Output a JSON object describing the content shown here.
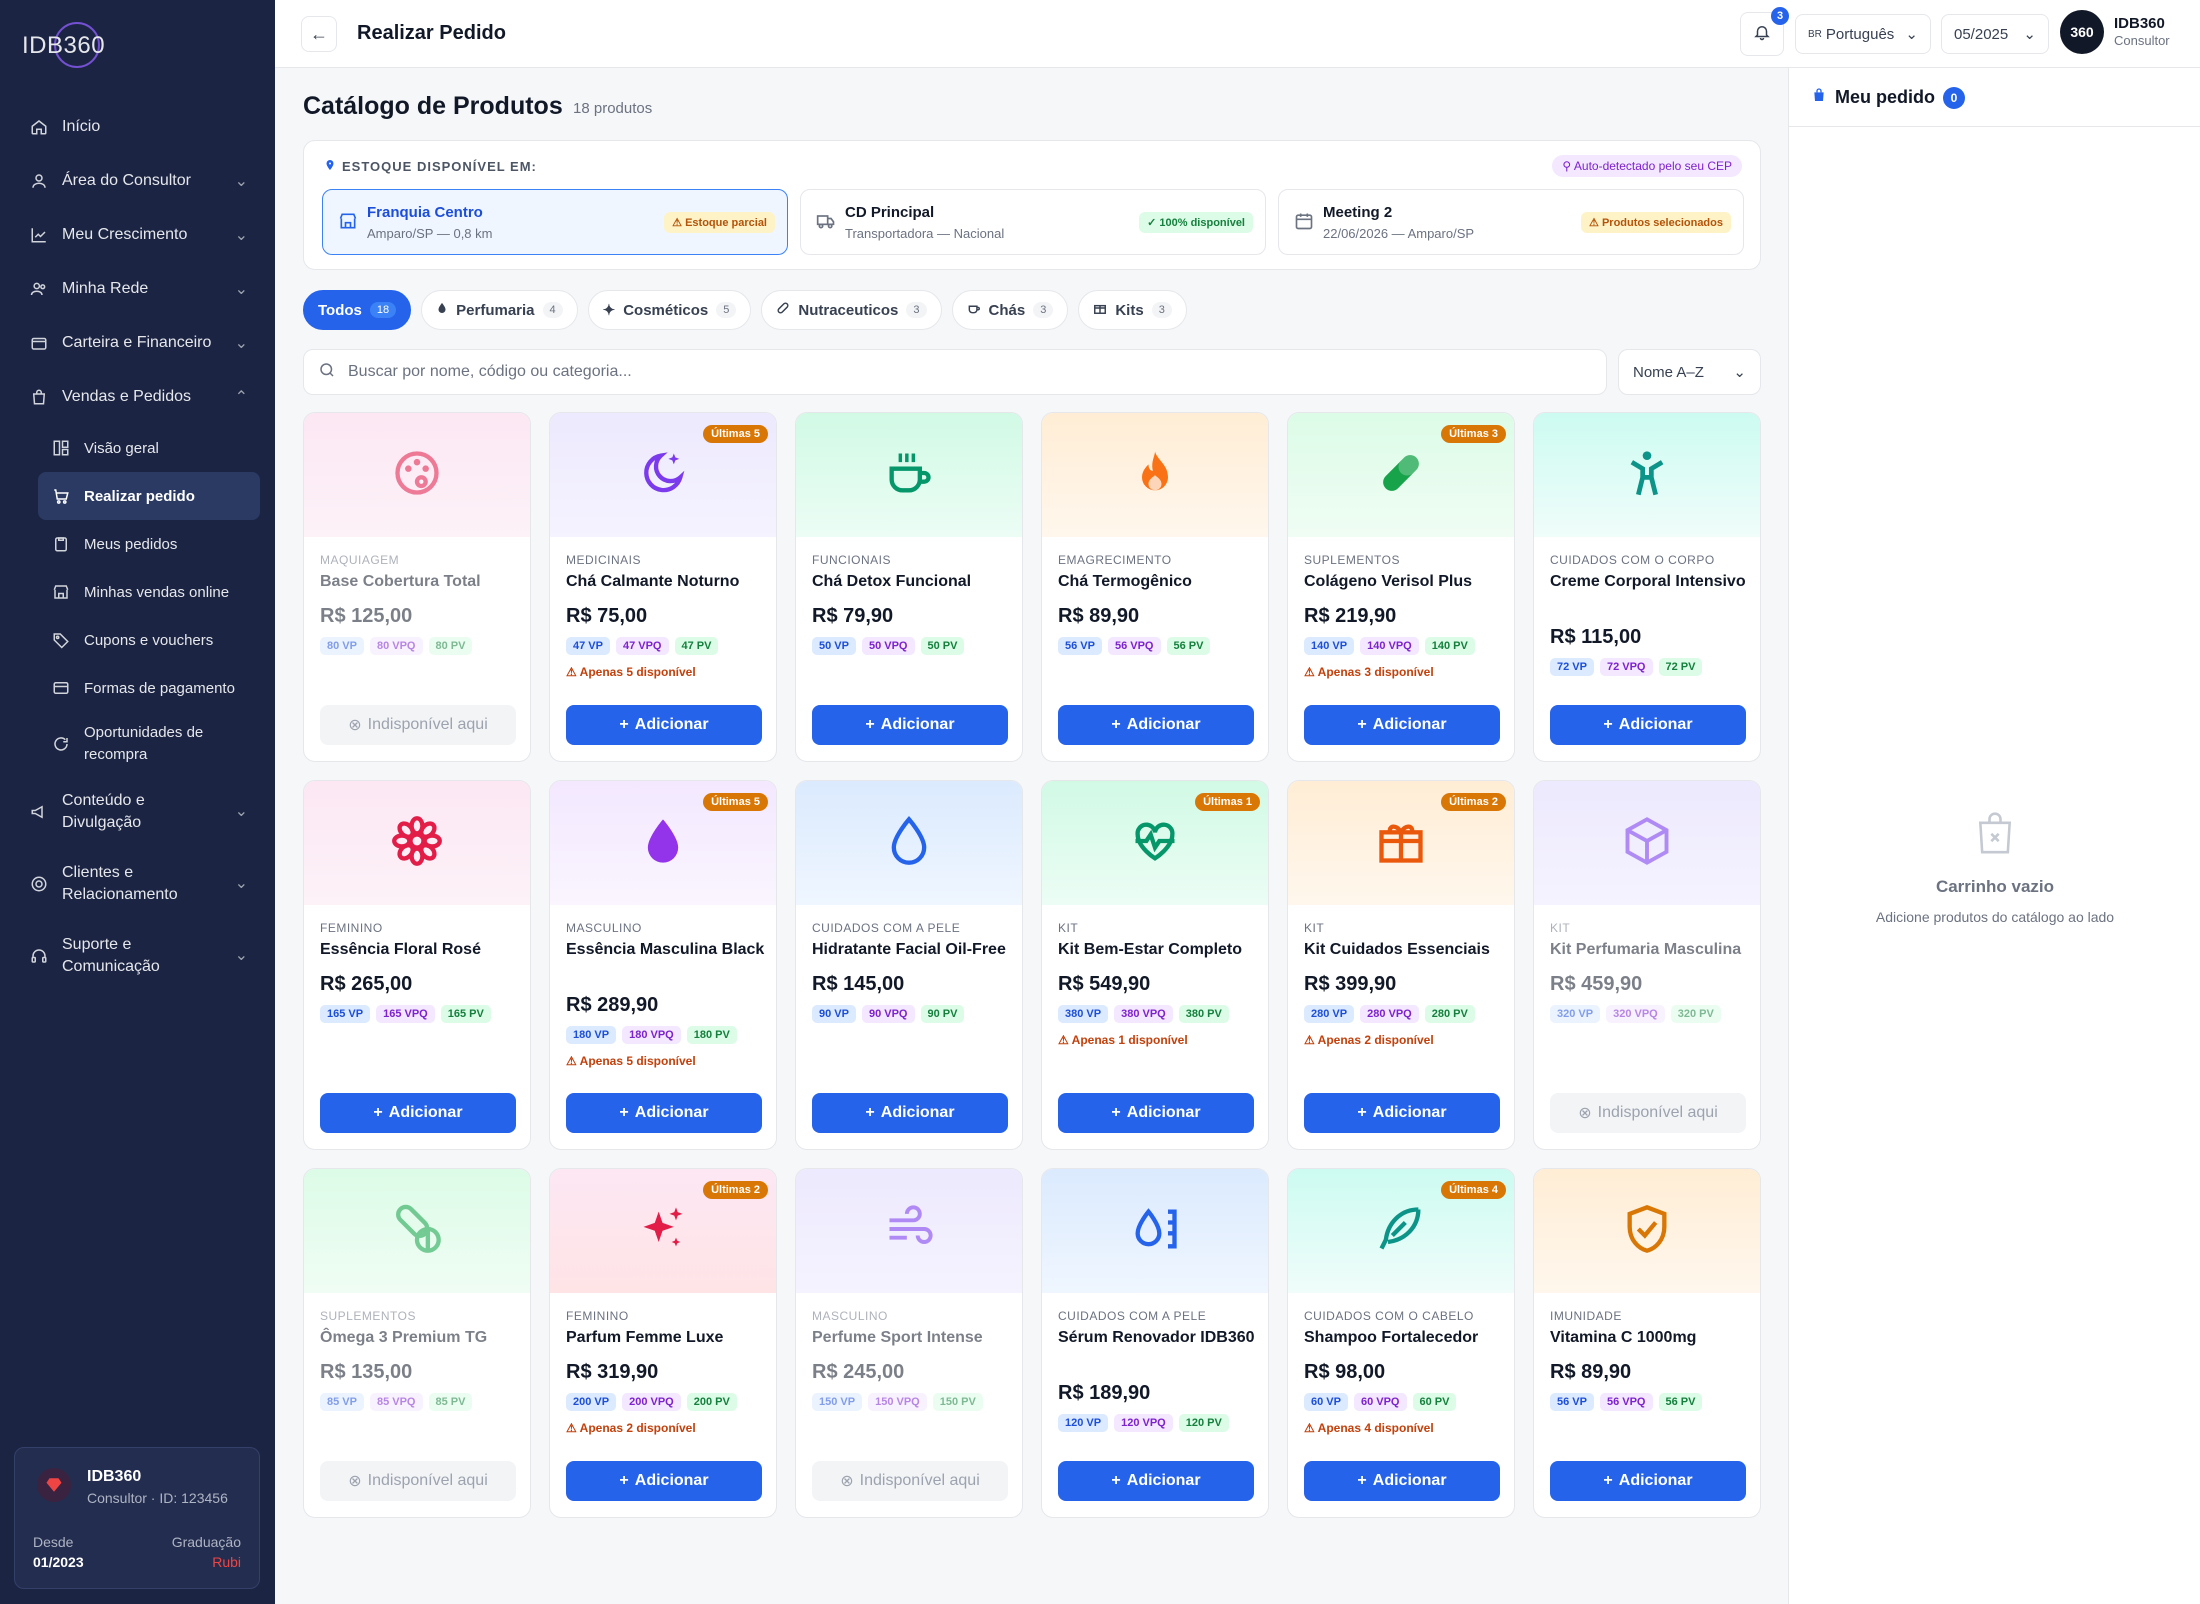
{
  "app": {
    "logo": "IDB360"
  },
  "sidebar": {
    "items": [
      {
        "label": "Início"
      },
      {
        "label": "Área do Consultor"
      },
      {
        "label": "Meu Crescimento"
      },
      {
        "label": "Minha Rede"
      },
      {
        "label": "Carteira e Financeiro"
      },
      {
        "label": "Vendas e Pedidos"
      }
    ],
    "sub": [
      {
        "label": "Visão geral"
      },
      {
        "label": "Realizar pedido"
      },
      {
        "label": "Meus pedidos"
      },
      {
        "label": "Minhas vendas online"
      },
      {
        "label": "Cupons e vouchers"
      },
      {
        "label": "Formas de pagamento"
      },
      {
        "label": "Oportunidades de recompra"
      }
    ],
    "items2": [
      {
        "label": "Conteúdo e Divulgação"
      },
      {
        "label": "Clientes e Relacionamento"
      },
      {
        "label": "Suporte e Comunicação"
      }
    ],
    "profile": {
      "name": "IDB360",
      "sub": "Consultor · ID: 123456",
      "since_label": "Desde",
      "since": "01/2023",
      "grad_label": "Graduação",
      "grad": "Rubi"
    }
  },
  "topbar": {
    "title": "Realizar Pedido",
    "notifications": "3",
    "language": "Português",
    "language_flag": "BR",
    "period": "05/2025",
    "avatar": "360",
    "user": "IDB360",
    "role": "Consultor"
  },
  "catalog": {
    "title": "Catálogo de Produtos",
    "count": "18 produtos"
  },
  "stock": {
    "label": "ESTOQUE DISPONÍVEL EM:",
    "auto": "Auto-detectado pelo seu CEP",
    "locations": [
      {
        "title": "Franquia Centro",
        "sub": "Amparo/SP — 0,8 km",
        "badge": "⚠ Estoque parcial"
      },
      {
        "title": "CD Principal",
        "sub": "Transportadora — Nacional",
        "badge": "✓ 100% disponível"
      },
      {
        "title": "Meeting 2",
        "sub": "22/06/2026 — Amparo/SP",
        "badge": "⚠ Produtos selecionados"
      }
    ]
  },
  "tabs": [
    {
      "label": "Todos",
      "count": "18"
    },
    {
      "label": "Perfumaria",
      "count": "4"
    },
    {
      "label": "Cosméticos",
      "count": "5"
    },
    {
      "label": "Nutraceuticos",
      "count": "3"
    },
    {
      "label": "Chás",
      "count": "3"
    },
    {
      "label": "Kits",
      "count": "3"
    }
  ],
  "search": {
    "placeholder": "Buscar por nome, código ou categoria..."
  },
  "sort": {
    "value": "Nome A–Z"
  },
  "actions": {
    "add": "Adicionar",
    "unavailable": "Indisponível aqui"
  },
  "products": [
    {
      "cat": "MAQUIAGEM",
      "name": "Base Cobertura Total",
      "price": "R$ 125,00",
      "vp": "80 VP",
      "vpq": "80 VPQ",
      "pv": "80 PV",
      "icon": "palette-icon"
    },
    {
      "cat": "MEDICINAIS",
      "name": "Chá Calmante Noturno",
      "price": "R$ 75,00",
      "vp": "47 VP",
      "vpq": "47 VPQ",
      "pv": "47 PV",
      "warn": "⚠ Apenas 5 disponível",
      "badge": "Últimas 5",
      "icon": "moon-stars-icon"
    },
    {
      "cat": "FUNCIONAIS",
      "name": "Chá Detox Funcional",
      "price": "R$ 79,90",
      "vp": "50 VP",
      "vpq": "50 VPQ",
      "pv": "50 PV",
      "icon": "coffee-cup-icon"
    },
    {
      "cat": "EMAGRECIMENTO",
      "name": "Chá Termogênico",
      "price": "R$ 89,90",
      "vp": "56 VP",
      "vpq": "56 VPQ",
      "pv": "56 PV",
      "icon": "flame-icon"
    },
    {
      "cat": "SUPLEMENTOS",
      "name": "Colágeno Verisol Plus",
      "price": "R$ 219,90",
      "vp": "140 VP",
      "vpq": "140 VPQ",
      "pv": "140 PV",
      "warn": "⚠ Apenas 3 disponível",
      "badge": "Últimas 3",
      "icon": "pill-icon"
    },
    {
      "cat": "CUIDADOS COM O CORPO",
      "name": "Creme Corporal Intensivo",
      "price": "R$ 115,00",
      "vp": "72 VP",
      "vpq": "72 VPQ",
      "pv": "72 PV",
      "icon": "person-standing-icon"
    },
    {
      "cat": "FEMININO",
      "name": "Essência Floral Rosé",
      "price": "R$ 265,00",
      "vp": "165 VP",
      "vpq": "165 VPQ",
      "pv": "165 PV",
      "icon": "flower-icon"
    },
    {
      "cat": "MASCULINO",
      "name": "Essência Masculina Black",
      "price": "R$ 289,90",
      "vp": "180 VP",
      "vpq": "180 VPQ",
      "pv": "180 PV",
      "warn": "⚠ Apenas 5 disponível",
      "badge": "Últimas 5",
      "icon": "drop-filled-icon"
    },
    {
      "cat": "CUIDADOS COM A PELE",
      "name": "Hidratante Facial Oil-Free",
      "price": "R$ 145,00",
      "vp": "90 VP",
      "vpq": "90 VPQ",
      "pv": "90 PV",
      "icon": "droplet-icon"
    },
    {
      "cat": "KIT",
      "name": "Kit Bem-Estar Completo",
      "price": "R$ 549,90",
      "vp": "380 VP",
      "vpq": "380 VPQ",
      "pv": "380 PV",
      "warn": "⚠ Apenas 1 disponível",
      "badge": "Últimas 1",
      "icon": "heart-pulse-icon"
    },
    {
      "cat": "KIT",
      "name": "Kit Cuidados Essenciais",
      "price": "R$ 399,90",
      "vp": "280 VP",
      "vpq": "280 VPQ",
      "pv": "280 PV",
      "warn": "⚠ Apenas 2 disponível",
      "badge": "Últimas 2",
      "icon": "gift-icon"
    },
    {
      "cat": "KIT",
      "name": "Kit Perfumaria Masculina",
      "price": "R$ 459,90",
      "vp": "320 VP",
      "vpq": "320 VPQ",
      "pv": "320 PV",
      "icon": "package-icon"
    },
    {
      "cat": "SUPLEMENTOS",
      "name": "Ômega 3 Premium TG",
      "price": "R$ 135,00",
      "vp": "85 VP",
      "vpq": "85 VPQ",
      "pv": "85 PV",
      "icon": "pills-icon"
    },
    {
      "cat": "FEMININO",
      "name": "Parfum Femme Luxe",
      "price": "R$ 319,90",
      "vp": "200 VP",
      "vpq": "200 VPQ",
      "pv": "200 PV",
      "warn": "⚠ Apenas 2 disponível",
      "badge": "Últimas 2",
      "icon": "sparkles-icon"
    },
    {
      "cat": "MASCULINO",
      "name": "Perfume Sport Intense",
      "price": "R$ 245,00",
      "vp": "150 VP",
      "vpq": "150 VPQ",
      "pv": "150 PV",
      "icon": "wind-icon"
    },
    {
      "cat": "CUIDADOS COM A PELE",
      "name": "Sérum Renovador IDB360",
      "price": "R$ 189,90",
      "vp": "120 VP",
      "vpq": "120 VPQ",
      "pv": "120 PV",
      "icon": "serum-drop-icon"
    },
    {
      "cat": "CUIDADOS COM O CABELO",
      "name": "Shampoo Fortalecedor",
      "price": "R$ 98,00",
      "vp": "60 VP",
      "vpq": "60 VPQ",
      "pv": "60 PV",
      "warn": "⚠ Apenas 4 disponível",
      "badge": "Últimas 4",
      "icon": "feather-icon"
    },
    {
      "cat": "IMUNIDADE",
      "name": "Vitamina C 1000mg",
      "price": "R$ 89,90",
      "vp": "56 VP",
      "vpq": "56 VPQ",
      "pv": "56 PV",
      "icon": "shield-check-icon"
    }
  ],
  "cart": {
    "title": "Meu pedido",
    "count": "0",
    "empty_title": "Carrinho vazio",
    "empty_sub": "Adicione produtos do catálogo ao lado"
  }
}
